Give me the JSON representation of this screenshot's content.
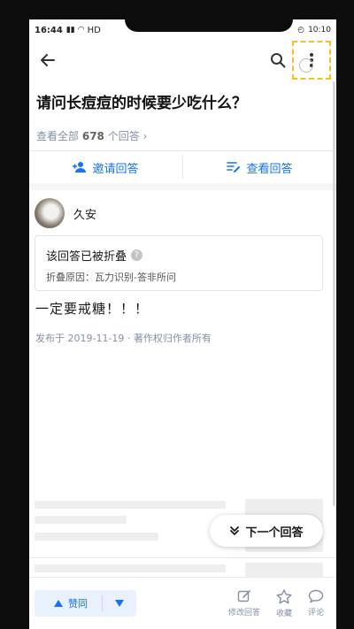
{
  "status_bar": {
    "time": "16:44",
    "network": "HD",
    "right_text": "10:10"
  },
  "question": {
    "title": "请问长痘痘的时候要少吃什么？",
    "view_all_prefix": "查看全部",
    "answer_count": "678",
    "view_all_suffix": "个回答 ›"
  },
  "actions": {
    "invite_label": "邀请回答",
    "view_label": "查看回答"
  },
  "answer": {
    "author_name": "久安",
    "folded_title": "该回答已被折叠",
    "folded_reason": "折叠原因：瓦力识别-答非所问",
    "content": "一定要戒糖！！！",
    "published": "发布于 2019-11-19 · 著作权归作者所有"
  },
  "next_answer_label": "下一个回答",
  "bottom_bar": {
    "vote_up_label": "赞同",
    "edit_label": "修改回答",
    "collect_label": "收藏",
    "comment_label": "评论"
  },
  "colors": {
    "accent": "#1772f6",
    "muted": "#8590a6",
    "highlight": "#f3c02b"
  }
}
